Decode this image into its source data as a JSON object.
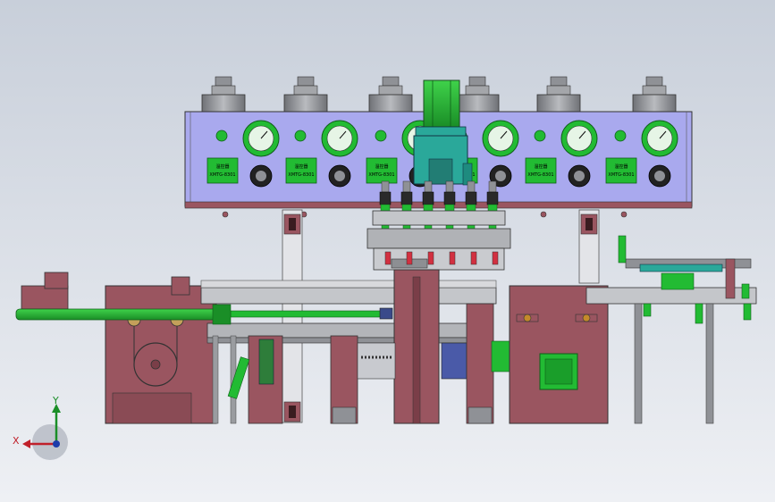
{
  "background": {
    "top": "#c8cfda",
    "bottom": "#eef0f4"
  },
  "colors": {
    "panel": "#a9a9ee",
    "frame": "#9a5560",
    "frame_dark": "#7a3e48",
    "steel": "#8f9196",
    "steel_light": "#c4c6ca",
    "green": "#22bb33",
    "teal": "#2aa89a"
  },
  "control_panel": {
    "controllers": [
      {
        "label_line1": "温控器",
        "label_line2": "XMTG-8301"
      },
      {
        "label_line1": "温控器",
        "label_line2": "XMTG-8301"
      },
      {
        "label_line1": "温控器",
        "label_line2": "XMTG-8301"
      },
      {
        "label_line1": "温控器",
        "label_line2": "XMTG-8301"
      },
      {
        "label_line1": "温控器",
        "label_line2": "XMTG-8301"
      },
      {
        "label_line1": "温控器",
        "label_line2": "XMTG-8301"
      }
    ]
  },
  "axes": {
    "y": "Y",
    "x": "X"
  },
  "icons": [
    "coordinate-triad-icon"
  ]
}
